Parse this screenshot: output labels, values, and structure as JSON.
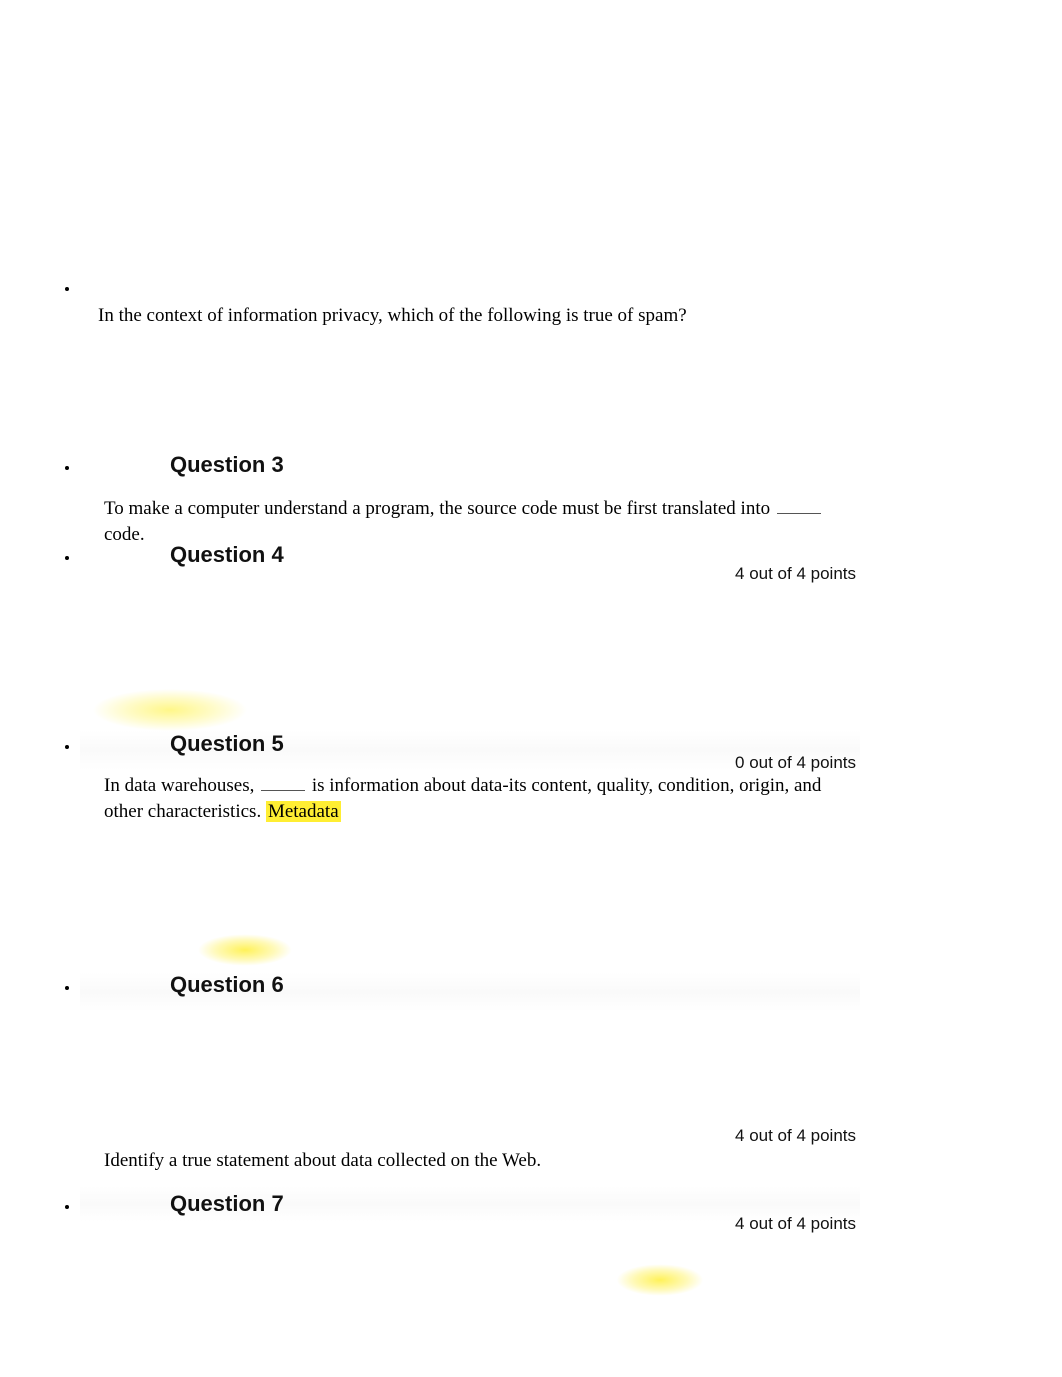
{
  "questions": [
    {
      "title": "",
      "points": "",
      "body_pre": "In the context of information privacy, which of the following is true of spam?",
      "body_post": "",
      "highlight": ""
    },
    {
      "title": "Question 3",
      "points": "",
      "body_pre": "To make a computer understand a program, the source code must be first translated into ",
      "body_post": " code.",
      "highlight": ""
    },
    {
      "title": "Question 4",
      "points": "4 out of 4 points",
      "body_pre": "",
      "body_post": "",
      "highlight": ""
    },
    {
      "title": "Question 5",
      "points": "0 out of 4 points",
      "body_pre": "In data warehouses, ",
      "body_post": " is information about data-its content, quality, condition, origin, and other characteristics. ",
      "highlight": "Metadata"
    },
    {
      "title": "Question 6",
      "points": "4 out of 4 points",
      "body_pre": "Identify a true statement about data collected on the Web.",
      "body_post": "",
      "highlight": ""
    },
    {
      "title": "Question 7",
      "points": "4 out of 4 points",
      "body_pre": "",
      "body_post": "",
      "highlight": ""
    }
  ]
}
